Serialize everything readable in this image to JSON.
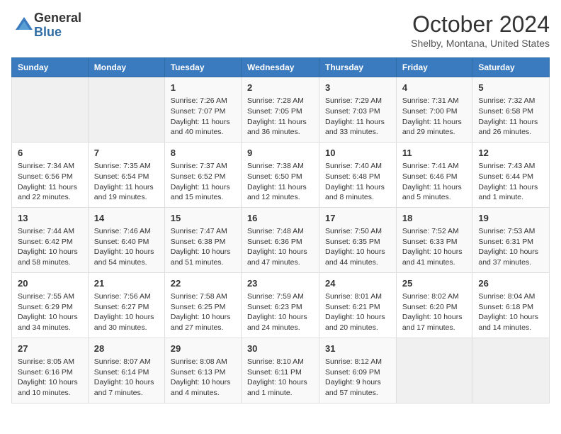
{
  "logo": {
    "general": "General",
    "blue": "Blue"
  },
  "title": "October 2024",
  "location": "Shelby, Montana, United States",
  "days_of_week": [
    "Sunday",
    "Monday",
    "Tuesday",
    "Wednesday",
    "Thursday",
    "Friday",
    "Saturday"
  ],
  "weeks": [
    [
      {
        "day": "",
        "info": ""
      },
      {
        "day": "",
        "info": ""
      },
      {
        "day": "1",
        "info": "Sunrise: 7:26 AM\nSunset: 7:07 PM\nDaylight: 11 hours and 40 minutes."
      },
      {
        "day": "2",
        "info": "Sunrise: 7:28 AM\nSunset: 7:05 PM\nDaylight: 11 hours and 36 minutes."
      },
      {
        "day": "3",
        "info": "Sunrise: 7:29 AM\nSunset: 7:03 PM\nDaylight: 11 hours and 33 minutes."
      },
      {
        "day": "4",
        "info": "Sunrise: 7:31 AM\nSunset: 7:00 PM\nDaylight: 11 hours and 29 minutes."
      },
      {
        "day": "5",
        "info": "Sunrise: 7:32 AM\nSunset: 6:58 PM\nDaylight: 11 hours and 26 minutes."
      }
    ],
    [
      {
        "day": "6",
        "info": "Sunrise: 7:34 AM\nSunset: 6:56 PM\nDaylight: 11 hours and 22 minutes."
      },
      {
        "day": "7",
        "info": "Sunrise: 7:35 AM\nSunset: 6:54 PM\nDaylight: 11 hours and 19 minutes."
      },
      {
        "day": "8",
        "info": "Sunrise: 7:37 AM\nSunset: 6:52 PM\nDaylight: 11 hours and 15 minutes."
      },
      {
        "day": "9",
        "info": "Sunrise: 7:38 AM\nSunset: 6:50 PM\nDaylight: 11 hours and 12 minutes."
      },
      {
        "day": "10",
        "info": "Sunrise: 7:40 AM\nSunset: 6:48 PM\nDaylight: 11 hours and 8 minutes."
      },
      {
        "day": "11",
        "info": "Sunrise: 7:41 AM\nSunset: 6:46 PM\nDaylight: 11 hours and 5 minutes."
      },
      {
        "day": "12",
        "info": "Sunrise: 7:43 AM\nSunset: 6:44 PM\nDaylight: 11 hours and 1 minute."
      }
    ],
    [
      {
        "day": "13",
        "info": "Sunrise: 7:44 AM\nSunset: 6:42 PM\nDaylight: 10 hours and 58 minutes."
      },
      {
        "day": "14",
        "info": "Sunrise: 7:46 AM\nSunset: 6:40 PM\nDaylight: 10 hours and 54 minutes."
      },
      {
        "day": "15",
        "info": "Sunrise: 7:47 AM\nSunset: 6:38 PM\nDaylight: 10 hours and 51 minutes."
      },
      {
        "day": "16",
        "info": "Sunrise: 7:48 AM\nSunset: 6:36 PM\nDaylight: 10 hours and 47 minutes."
      },
      {
        "day": "17",
        "info": "Sunrise: 7:50 AM\nSunset: 6:35 PM\nDaylight: 10 hours and 44 minutes."
      },
      {
        "day": "18",
        "info": "Sunrise: 7:52 AM\nSunset: 6:33 PM\nDaylight: 10 hours and 41 minutes."
      },
      {
        "day": "19",
        "info": "Sunrise: 7:53 AM\nSunset: 6:31 PM\nDaylight: 10 hours and 37 minutes."
      }
    ],
    [
      {
        "day": "20",
        "info": "Sunrise: 7:55 AM\nSunset: 6:29 PM\nDaylight: 10 hours and 34 minutes."
      },
      {
        "day": "21",
        "info": "Sunrise: 7:56 AM\nSunset: 6:27 PM\nDaylight: 10 hours and 30 minutes."
      },
      {
        "day": "22",
        "info": "Sunrise: 7:58 AM\nSunset: 6:25 PM\nDaylight: 10 hours and 27 minutes."
      },
      {
        "day": "23",
        "info": "Sunrise: 7:59 AM\nSunset: 6:23 PM\nDaylight: 10 hours and 24 minutes."
      },
      {
        "day": "24",
        "info": "Sunrise: 8:01 AM\nSunset: 6:21 PM\nDaylight: 10 hours and 20 minutes."
      },
      {
        "day": "25",
        "info": "Sunrise: 8:02 AM\nSunset: 6:20 PM\nDaylight: 10 hours and 17 minutes."
      },
      {
        "day": "26",
        "info": "Sunrise: 8:04 AM\nSunset: 6:18 PM\nDaylight: 10 hours and 14 minutes."
      }
    ],
    [
      {
        "day": "27",
        "info": "Sunrise: 8:05 AM\nSunset: 6:16 PM\nDaylight: 10 hours and 10 minutes."
      },
      {
        "day": "28",
        "info": "Sunrise: 8:07 AM\nSunset: 6:14 PM\nDaylight: 10 hours and 7 minutes."
      },
      {
        "day": "29",
        "info": "Sunrise: 8:08 AM\nSunset: 6:13 PM\nDaylight: 10 hours and 4 minutes."
      },
      {
        "day": "30",
        "info": "Sunrise: 8:10 AM\nSunset: 6:11 PM\nDaylight: 10 hours and 1 minute."
      },
      {
        "day": "31",
        "info": "Sunrise: 8:12 AM\nSunset: 6:09 PM\nDaylight: 9 hours and 57 minutes."
      },
      {
        "day": "",
        "info": ""
      },
      {
        "day": "",
        "info": ""
      }
    ]
  ]
}
